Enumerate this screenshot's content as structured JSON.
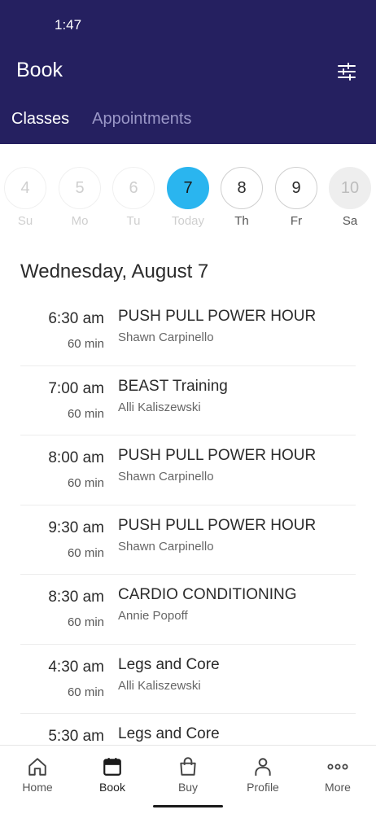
{
  "status_bar": {
    "time": "1:47"
  },
  "header": {
    "title": "Book",
    "filter_icon": "sliders-icon",
    "tabs": [
      {
        "label": "Classes",
        "active": true
      },
      {
        "label": "Appointments",
        "active": false
      }
    ]
  },
  "week": [
    {
      "num": "4",
      "label": "Su",
      "state": "past"
    },
    {
      "num": "5",
      "label": "Mo",
      "state": "past"
    },
    {
      "num": "6",
      "label": "Tu",
      "state": "past"
    },
    {
      "num": "7",
      "label": "Today",
      "state": "selected"
    },
    {
      "num": "8",
      "label": "Th",
      "state": "normal"
    },
    {
      "num": "9",
      "label": "Fr",
      "state": "normal"
    },
    {
      "num": "10",
      "label": "Sa",
      "state": "disabled"
    }
  ],
  "date_heading": "Wednesday, August 7",
  "classes": [
    {
      "time": "6:30 am",
      "duration": "60 min",
      "name": "PUSH PULL POWER HOUR",
      "instructor": "Shawn Carpinello"
    },
    {
      "time": "7:00 am",
      "duration": "60 min",
      "name": "BEAST Training",
      "instructor": "Alli Kaliszewski"
    },
    {
      "time": "8:00 am",
      "duration": "60 min",
      "name": "PUSH PULL POWER HOUR",
      "instructor": "Shawn Carpinello"
    },
    {
      "time": "9:30 am",
      "duration": "60 min",
      "name": "PUSH PULL POWER HOUR",
      "instructor": "Shawn Carpinello"
    },
    {
      "time": "8:30 am",
      "duration": "60 min",
      "name": "CARDIO CONDITIONING",
      "instructor": "Annie Popoff"
    },
    {
      "time": "4:30 am",
      "duration": "60 min",
      "name": "Legs and Core",
      "instructor": "Alli Kaliszewski"
    },
    {
      "time": "5:30 am",
      "duration": "",
      "name": "Legs and Core",
      "instructor": ""
    }
  ],
  "bottom_nav": [
    {
      "label": "Home",
      "icon": "home-icon",
      "active": false
    },
    {
      "label": "Book",
      "icon": "calendar-icon",
      "active": true
    },
    {
      "label": "Buy",
      "icon": "shopping-bag-icon",
      "active": false
    },
    {
      "label": "Profile",
      "icon": "person-icon",
      "active": false
    },
    {
      "label": "More",
      "icon": "more-dots-icon",
      "active": false
    }
  ],
  "colors": {
    "header_bg": "#252060",
    "selected_day": "#2ab5ef",
    "inactive_tab": "#9a97c7"
  }
}
